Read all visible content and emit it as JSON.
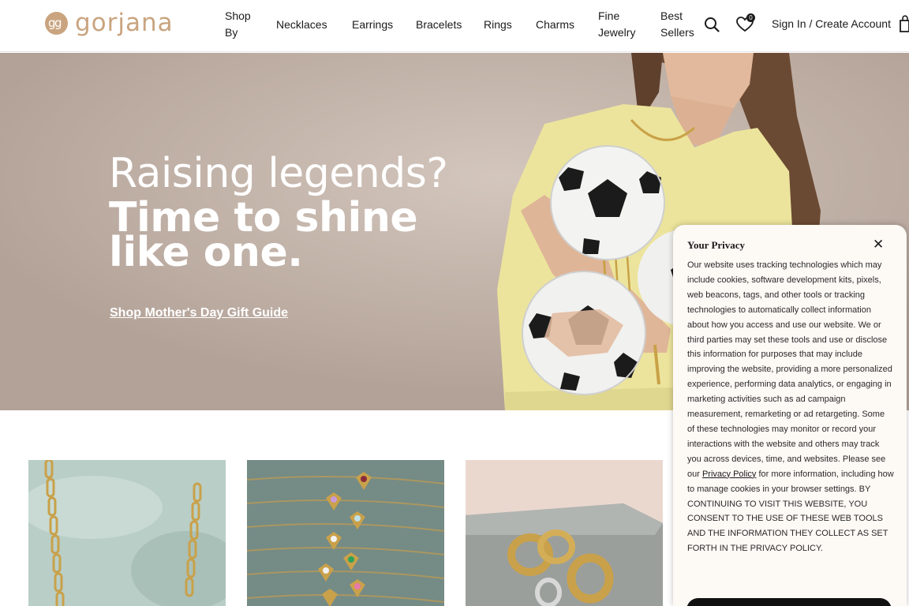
{
  "header": {
    "logo_mark": "gg",
    "logo_text": "gorjana",
    "nav": [
      {
        "line1": "Shop",
        "line2": "By"
      },
      {
        "line1": "Necklaces",
        "line2": ""
      },
      {
        "line1": "Earrings",
        "line2": ""
      },
      {
        "line1": "Bracelets",
        "line2": ""
      },
      {
        "line1": "Rings",
        "line2": ""
      },
      {
        "line1": "Charms",
        "line2": ""
      },
      {
        "line1": "Fine",
        "line2": "Jewelry"
      },
      {
        "line1": "Best",
        "line2": "Sellers"
      }
    ],
    "search_icon": "search-icon",
    "wishlist_icon": "heart-icon",
    "wishlist_count": "0",
    "account_link": "Sign In / Create Account",
    "cart_icon": "shopping-bag-icon"
  },
  "hero": {
    "headline": "Raising legends?",
    "subheadline_line1": "Time to shine",
    "subheadline_line2": "like one.",
    "cta": "Shop Mother's Day Gift Guide"
  },
  "products": [
    {
      "image": "gold paperclip chain necklace on green stone"
    },
    {
      "image": "heart charm bracelets with colored stones"
    },
    {
      "image": "gold and silver hoop earrings on stone"
    }
  ],
  "privacy": {
    "title": "Your Privacy",
    "close_icon": "close-icon",
    "body_before_link": "Our website uses tracking technologies which may include cookies, software development kits, pixels, web beacons, tags, and other tools or tracking technologies to automatically collect information about how you access and use our website. We or third parties may set these tools and use or disclose this information for purposes that may include improving the website, providing a more personalized experience, performing data analytics, or engaging in marketing activities such as ad campaign measurement, remarketing or ad retargeting. Some of these technologies may monitor or record your interactions with the website and others may track you across devices, time, and websites. Please see our ",
    "link": "Privacy Policy",
    "body_after_link": " for more information, including how to manage cookies in your browser settings. BY CONTINUING TO VISIT THIS WEBSITE, YOU CONSENT TO THE USE OF THESE WEB TOOLS AND THE INFORMATION THEY COLLECT AS SET FORTH IN THE PRIVACY POLICY."
  },
  "colors": {
    "brand_gold": "#c9a47f",
    "text_dark": "#1a1a1a",
    "modal_bg": "#fdf9f5"
  }
}
